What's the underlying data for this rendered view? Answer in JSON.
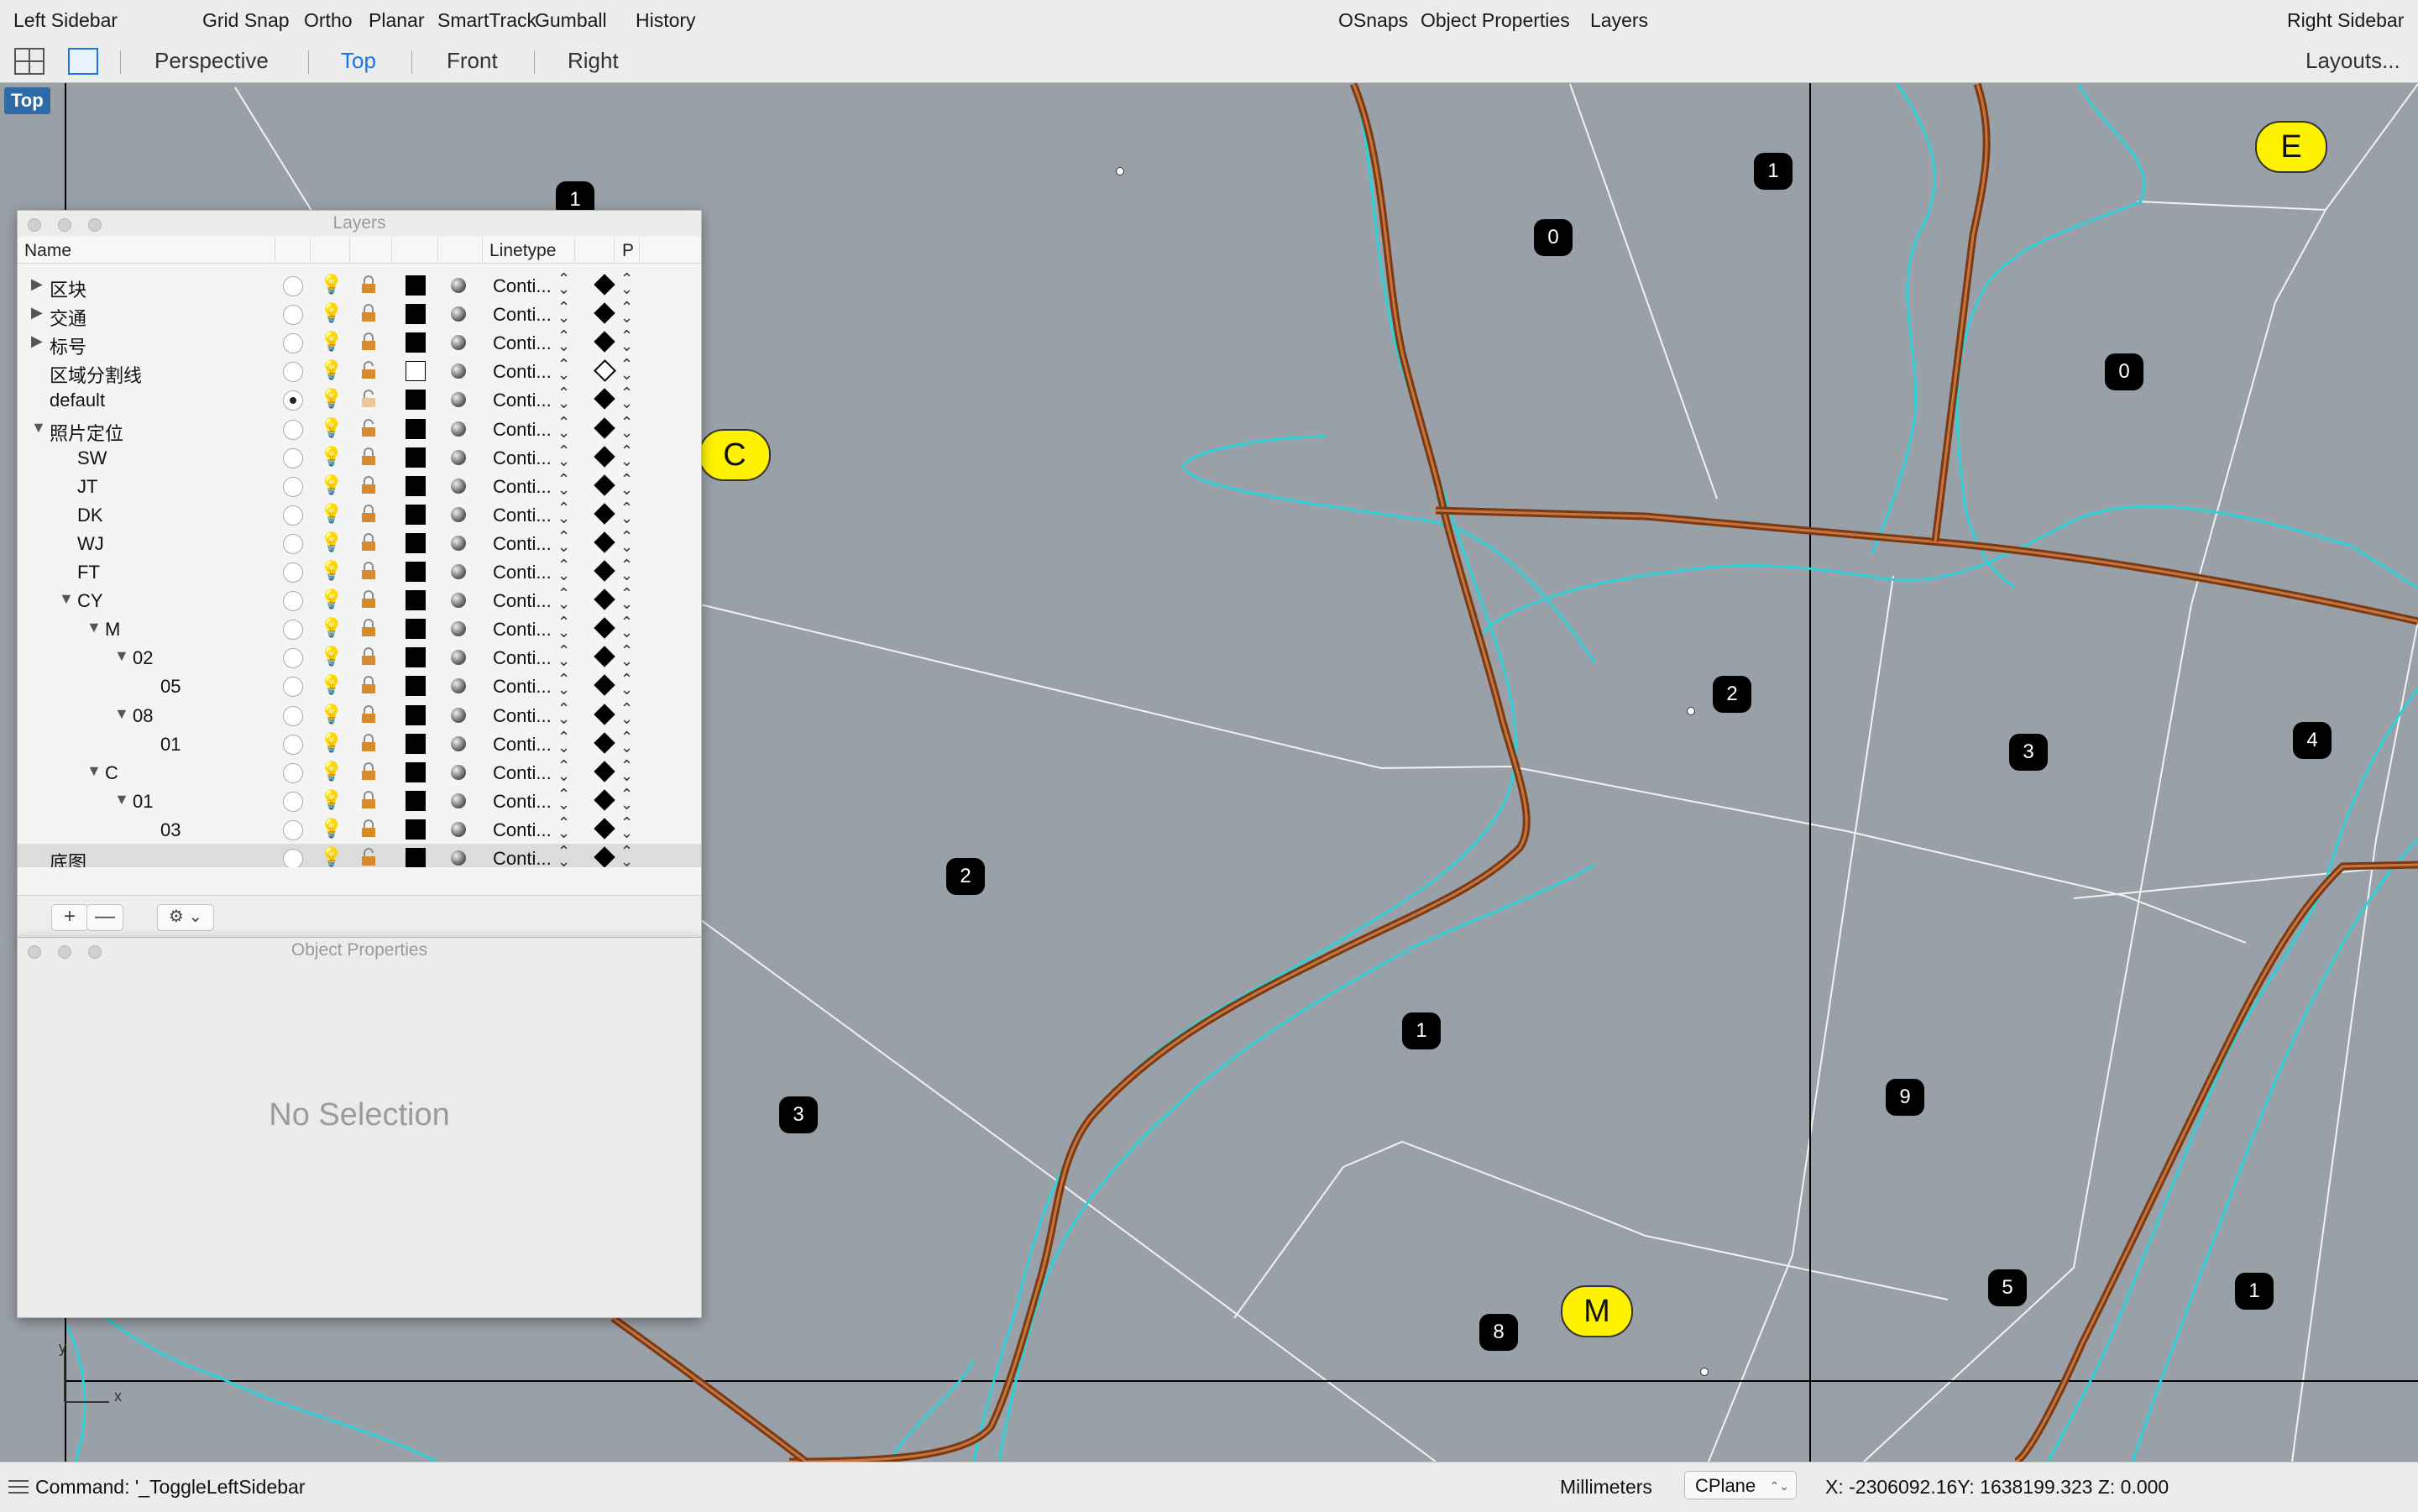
{
  "topbar": {
    "left_sidebar": "Left Sidebar",
    "grid_snap": "Grid Snap",
    "ortho": "Ortho",
    "planar": "Planar",
    "smarttrack": "SmartTrack",
    "gumball": "Gumball",
    "history": "History",
    "osnaps": "OSnaps",
    "object_properties": "Object Properties",
    "layers": "Layers",
    "right_sidebar": "Right Sidebar"
  },
  "viewbar": {
    "tabs": [
      "Perspective",
      "Top",
      "Front",
      "Right"
    ],
    "active_tab": "Top",
    "layouts": "Layouts..."
  },
  "viewport": {
    "label": "Top",
    "badges": [
      "1",
      "0",
      "1",
      "0",
      "2",
      "3",
      "4",
      "2",
      "1",
      "3",
      "9",
      "5",
      "1",
      "8"
    ],
    "yellow_badges": [
      "E",
      "C",
      "M"
    ],
    "axis_x": "x",
    "axis_y": "y",
    "colors": {
      "background": "#9aa0a8",
      "contour": "#2ed1d8",
      "road": "#7a3b14",
      "road_fill": "#c7743e"
    }
  },
  "layers_panel": {
    "title": "Layers",
    "columns": {
      "name": "Name",
      "linetype": "Linetype",
      "print": "P"
    },
    "rows": [
      {
        "name": "区块",
        "lt": "Conti...",
        "expander": "▶"
      },
      {
        "name": "交通",
        "lt": "Conti...",
        "expander": "▶"
      },
      {
        "name": "标号",
        "lt": "Conti...",
        "expander": "▶"
      },
      {
        "name": "区域分割线",
        "lt": "Conti...",
        "expander": ""
      },
      {
        "name": "default",
        "lt": "Conti...",
        "expander": ""
      },
      {
        "name": "照片定位",
        "lt": "Conti...",
        "expander": "▼"
      },
      {
        "name": "SW",
        "lt": "Conti...",
        "expander": ""
      },
      {
        "name": "JT",
        "lt": "Conti...",
        "expander": ""
      },
      {
        "name": "DK",
        "lt": "Conti...",
        "expander": ""
      },
      {
        "name": "WJ",
        "lt": "Conti...",
        "expander": ""
      },
      {
        "name": "FT",
        "lt": "Conti...",
        "expander": ""
      },
      {
        "name": "CY",
        "lt": "Conti...",
        "expander": "▼"
      },
      {
        "name": "M",
        "lt": "Conti...",
        "expander": "▼"
      },
      {
        "name": "02",
        "lt": "Conti...",
        "expander": "▼"
      },
      {
        "name": "05",
        "lt": "Conti...",
        "expander": ""
      },
      {
        "name": "08",
        "lt": "Conti...",
        "expander": "▼"
      },
      {
        "name": "01",
        "lt": "Conti...",
        "expander": ""
      },
      {
        "name": "C",
        "lt": "Conti...",
        "expander": "▼"
      },
      {
        "name": "01",
        "lt": "Conti...",
        "expander": "▼"
      },
      {
        "name": "03",
        "lt": "Conti...",
        "expander": ""
      },
      {
        "name": "底图",
        "lt": "Conti...",
        "expander": ""
      }
    ],
    "current_layer": "default",
    "selected_layer": "底图",
    "add_label": "+",
    "remove_label": "—",
    "gear_label": "⚙ ⌄"
  },
  "object_properties_panel": {
    "title": "Object Properties",
    "empty_text": "No Selection"
  },
  "statusbar": {
    "command": "Command: '_ToggleLeftSidebar",
    "units": "Millimeters",
    "cplane": "CPlane",
    "coords": "X: -2306092.16Y: 1638199.323 Z: 0.000"
  }
}
